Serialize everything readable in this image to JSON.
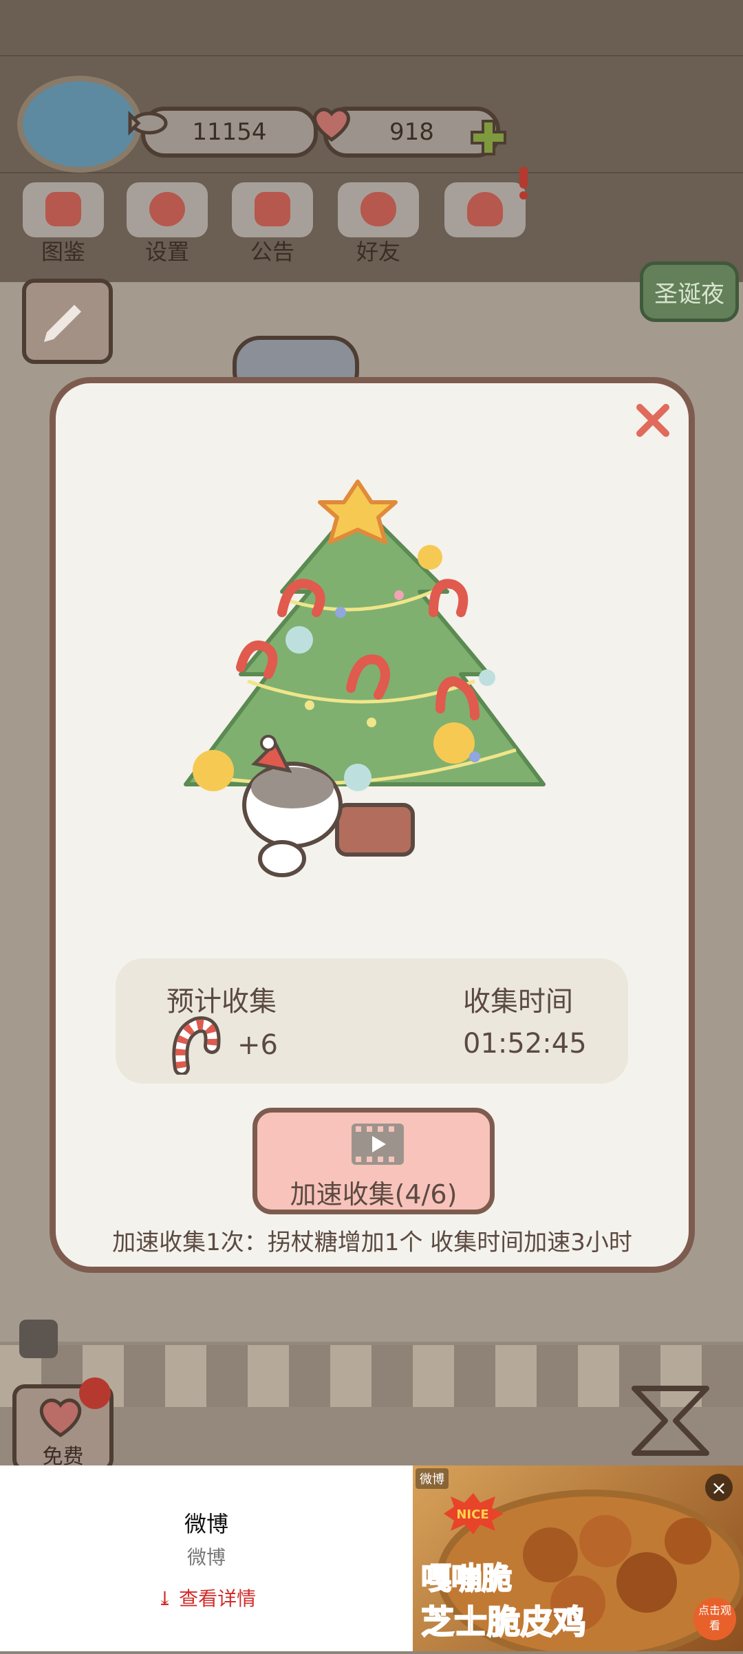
{
  "hud": {
    "fish_count": "11154",
    "heart_count": "918"
  },
  "menu": [
    {
      "label": "图鉴",
      "icon": "cat-face-icon"
    },
    {
      "label": "设置",
      "icon": "gear-icon"
    },
    {
      "label": "公告",
      "icon": "gift-icon"
    },
    {
      "label": "好友",
      "icon": "friends-icon"
    },
    {
      "label": "",
      "icon": "mail-hearts-icon"
    }
  ],
  "event_button": "圣诞夜",
  "modal": {
    "expected_label": "预计收集",
    "expected_value": "+6",
    "time_label": "收集时间",
    "time_value": "01:52:45",
    "speed_button": "加速收集(4/6)",
    "note": "加速收集1次：拐杖糖增加1个 收集时间加速3小时"
  },
  "bottom": {
    "free_label": "免费"
  },
  "ad": {
    "title": "微博",
    "subtitle": "微博",
    "link": "查看详情",
    "logo": "微博",
    "badge": "NICE",
    "headline_1": "嘎嘣脆",
    "headline_2": "芝士脆皮鸡",
    "cta": "点击观看"
  },
  "colors": {
    "modal_bg": "#f4f2ec",
    "modal_border": "#7d5c4f",
    "accent_red": "#e06a5c",
    "button_pink": "#f7c3bb",
    "event_green": "#64805a"
  }
}
